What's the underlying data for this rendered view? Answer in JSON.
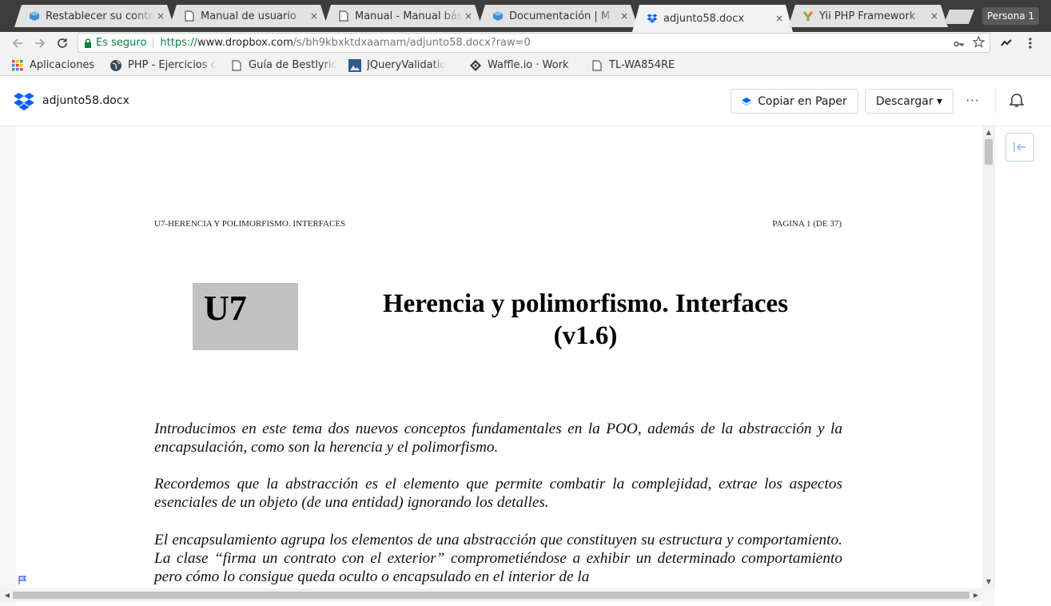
{
  "browser": {
    "tabs": [
      {
        "title": "Restablecer su contraseña",
        "icon": "blue-cube-icon",
        "active": false
      },
      {
        "title": "Manual de usuario",
        "icon": "document-icon",
        "active": false
      },
      {
        "title": "Manual - Manual básico",
        "icon": "document-icon",
        "active": false
      },
      {
        "title": "Documentación | M",
        "icon": "blue-cube-icon",
        "active": false
      },
      {
        "title": "adjunto58.docx",
        "icon": "dropbox-icon",
        "active": true
      },
      {
        "title": "Yii PHP Framework",
        "icon": "yii-icon",
        "active": false
      }
    ],
    "close_glyph": "×",
    "profile_label": "Persona 1",
    "omnibox": {
      "secure_label": "Es seguro",
      "url_scheme": "https://",
      "url_host": "www.dropbox.com",
      "url_path": "/s/bh9kbxktdxaamam/adjunto58.docx?raw=0"
    },
    "bookmarks": [
      {
        "label": "Aplicaciones",
        "icon": "apps-grid-icon"
      },
      {
        "label": "PHP - Ejercicios c",
        "icon": "globe-icon"
      },
      {
        "label": "Guía de Bestlyric",
        "icon": "document-icon"
      },
      {
        "label": "JQueryValidatio",
        "icon": "image-icon"
      },
      {
        "label": "Waffle.io · Work",
        "icon": "waffle-icon"
      },
      {
        "label": "TL-WA854RE",
        "icon": "document-icon"
      }
    ]
  },
  "dropbox": {
    "file_name": "adjunto58.docx",
    "copy_paper_label": "Copiar en Paper",
    "download_label": "Descargar ▾",
    "more_label": "···"
  },
  "document": {
    "header_left": "U7-HERENCIA Y POLIMORFISMO. INTERFACES",
    "header_right": "PAGINA 1 (DE 37)",
    "unit_label": "U7",
    "title_line1": "Herencia y polimorfismo. Interfaces",
    "title_line2": "(v1.6)",
    "paragraphs": [
      "Introducimos en este tema dos nuevos conceptos fundamentales en la POO, además de la abstracción y la encapsulación, como son la herencia y el polimorfismo.",
      "Recordemos que la abstracción es el elemento que permite combatir la complejidad, extrae los aspectos esenciales de un objeto (de una entidad) ignorando los detalles.",
      "El encapsulamiento agrupa los elementos de una abstracción que constituyen su estructura y comportamiento. La clase “firma un contrato con el exterior”  comprometiéndose a exhibir un determinado comportamiento pero cómo lo consigue queda oculto o encapsulado en el interior de la"
    ]
  },
  "colors": {
    "dropbox_blue": "#0061ff",
    "secure_green": "#0b8043",
    "unit_box_gray": "#c1c1c1"
  }
}
